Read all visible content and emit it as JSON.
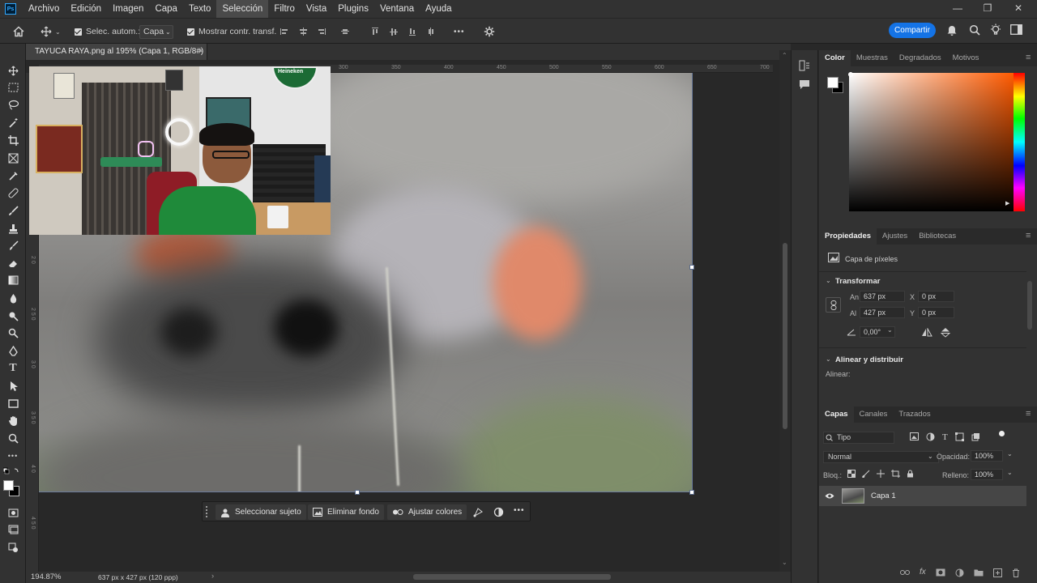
{
  "menubar": {
    "items": [
      "Archivo",
      "Edición",
      "Imagen",
      "Capa",
      "Texto",
      "Selección",
      "Filtro",
      "Vista",
      "Plugins",
      "Ventana",
      "Ayuda"
    ],
    "active_item": "Selección",
    "window_controls": [
      "—",
      "❐",
      "✕"
    ]
  },
  "options_bar": {
    "auto_select_label": "Selec. autom.:",
    "auto_select_value": "Capa",
    "show_transform_label": "Mostrar contr. transf.",
    "more": "•••",
    "share_button": "Compartir"
  },
  "document": {
    "tab_title": "TAYUCA RAYA.png al 195% (Capa 1, RGB/8#)",
    "close": "×",
    "zoom": "194.87%",
    "dimensions": "637 px x 427 px (120 ppp)",
    "status_arrow": "›"
  },
  "rulers": {
    "top_ticks": [
      "300",
      "350",
      "400",
      "450",
      "500",
      "550",
      "600",
      "650",
      "700"
    ],
    "left_ticks": [
      "2 0",
      "2 5 0",
      "3 0",
      "3 5 0",
      "4 0",
      "4 5 0"
    ]
  },
  "webcam": {
    "sign": "Heineken"
  },
  "floating_bar": {
    "select_subject": "Seleccionar sujeto",
    "remove_background": "Eliminar fondo",
    "adjust_colors": "Ajustar colores",
    "more": "•••"
  },
  "color_panel": {
    "tabs": [
      "Color",
      "Muestras",
      "Degradados",
      "Motivos"
    ],
    "active_tab": "Color",
    "foreground": "#ffffff",
    "background": "#000000",
    "hue_color": "#ff5a00"
  },
  "properties_panel": {
    "tabs": [
      "Propiedades",
      "Ajustes",
      "Bibliotecas"
    ],
    "active_tab": "Propiedades",
    "layer_type": "Capa de píxeles",
    "transform_heading": "Transformar",
    "width_label": "An",
    "width_value": "637 px",
    "height_label": "Al",
    "height_value": "427 px",
    "x_label": "X",
    "x_value": "0 px",
    "y_label": "Y",
    "y_value": "0 px",
    "angle_value": "0,00°",
    "align_heading": "Alinear y distribuir",
    "align_label": "Alinear:"
  },
  "layers_panel": {
    "tabs": [
      "Capas",
      "Canales",
      "Trazados"
    ],
    "active_tab": "Capas",
    "filter_kind": "Tipo",
    "blend_mode": "Normal",
    "opacity_label": "Opacidad:",
    "opacity_value": "100%",
    "lock_label": "Bloq.:",
    "fill_label": "Relleno:",
    "fill_value": "100%",
    "layers": [
      {
        "name": "Capa 1",
        "visible": true,
        "selected": true
      }
    ]
  }
}
